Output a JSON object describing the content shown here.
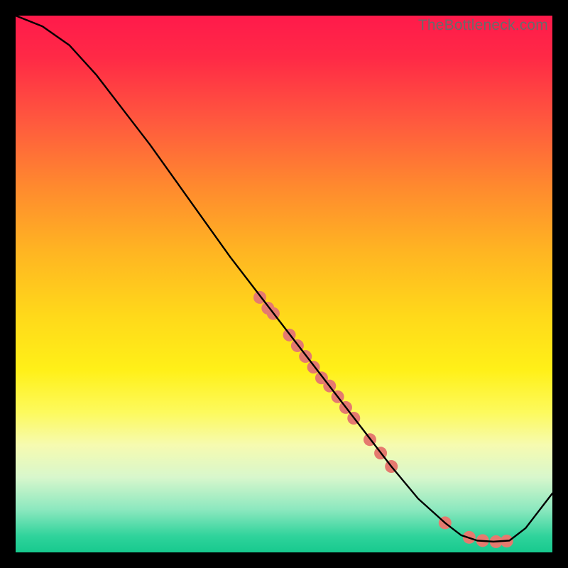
{
  "watermark": "TheBottleneck.com",
  "chart_data": {
    "type": "line",
    "title": "",
    "xlabel": "",
    "ylabel": "",
    "xlim": [
      0,
      100
    ],
    "ylim": [
      0,
      100
    ],
    "grid": false,
    "series": [
      {
        "name": "curve",
        "color": "#000000",
        "x": [
          0,
          5,
          10,
          15,
          20,
          25,
          30,
          35,
          40,
          45,
          50,
          55,
          60,
          65,
          70,
          75,
          80,
          83,
          86,
          89,
          92,
          95,
          100
        ],
        "y": [
          100,
          98,
          94.5,
          89,
          82.5,
          76,
          69,
          62,
          55,
          48.5,
          42,
          35.5,
          29,
          22.5,
          16,
          10,
          5.5,
          3.2,
          2.2,
          2.0,
          2.2,
          4.5,
          11
        ]
      }
    ],
    "markers": {
      "name": "dots",
      "color": "#e57a6f",
      "radius_px": 9,
      "points": [
        {
          "x": 45.5,
          "y": 47.5
        },
        {
          "x": 47.0,
          "y": 45.5
        },
        {
          "x": 48.0,
          "y": 44.5
        },
        {
          "x": 51.0,
          "y": 40.5
        },
        {
          "x": 52.5,
          "y": 38.5
        },
        {
          "x": 54.0,
          "y": 36.5
        },
        {
          "x": 55.5,
          "y": 34.5
        },
        {
          "x": 57.0,
          "y": 32.5
        },
        {
          "x": 58.5,
          "y": 31.0
        },
        {
          "x": 60.0,
          "y": 29.0
        },
        {
          "x": 61.5,
          "y": 27.0
        },
        {
          "x": 63.0,
          "y": 25.0
        },
        {
          "x": 66.0,
          "y": 21.0
        },
        {
          "x": 68.0,
          "y": 18.5
        },
        {
          "x": 70.0,
          "y": 16.0
        },
        {
          "x": 80.0,
          "y": 5.5
        },
        {
          "x": 84.5,
          "y": 2.8
        },
        {
          "x": 87.0,
          "y": 2.2
        },
        {
          "x": 89.5,
          "y": 2.0
        },
        {
          "x": 91.5,
          "y": 2.1
        }
      ]
    }
  }
}
